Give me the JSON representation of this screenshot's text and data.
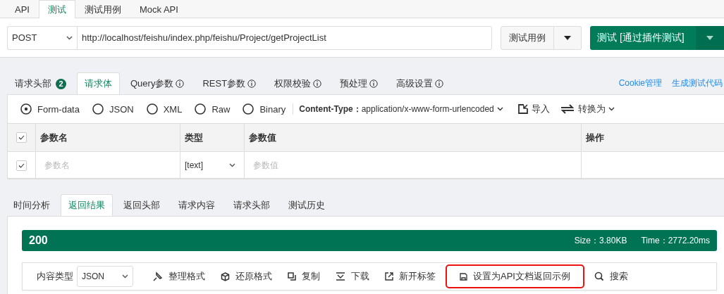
{
  "top_tabs": [
    {
      "label": "API",
      "selected": false
    },
    {
      "label": "测试",
      "selected": true
    },
    {
      "label": "测试用例",
      "selected": false
    },
    {
      "label": "Mock API",
      "selected": false
    }
  ],
  "request": {
    "method": "POST",
    "url": "http://localhost/feishu/index.php/feishu/Project/getProjectList",
    "case_button": "测试用例",
    "test_button": "测试 [通过插件测试]"
  },
  "request_tabs": [
    {
      "label": "请求头部",
      "badge": "2",
      "info": false,
      "selected": false
    },
    {
      "label": "请求体",
      "info": false,
      "selected": true
    },
    {
      "label": "Query参数",
      "info": true,
      "selected": false
    },
    {
      "label": "REST参数",
      "info": true,
      "selected": false
    },
    {
      "label": "权限校验",
      "info": true,
      "selected": false
    },
    {
      "label": "预处理",
      "info": true,
      "selected": false
    },
    {
      "label": "高级设置",
      "info": true,
      "selected": false
    }
  ],
  "request_links": [
    "Cookie管理",
    "生成测试代码"
  ],
  "body_types": [
    {
      "label": "Form-data",
      "selected": true
    },
    {
      "label": "JSON",
      "selected": false
    },
    {
      "label": "XML",
      "selected": false
    },
    {
      "label": "Raw",
      "selected": false
    },
    {
      "label": "Binary",
      "selected": false
    }
  ],
  "content_type": {
    "label": "Content-Type：",
    "value": "application/x-www-form-urlencoded"
  },
  "body_actions": [
    "导入",
    "转换为"
  ],
  "params_table": {
    "all_checked": true,
    "columns": [
      "参数名",
      "类型",
      "参数值",
      "操作"
    ],
    "rows": [
      {
        "checked": true,
        "name_placeholder": "参数名",
        "type": "[text]",
        "value_placeholder": "参数值"
      }
    ]
  },
  "response_tabs": [
    {
      "label": "时间分析",
      "selected": false
    },
    {
      "label": "返回结果",
      "selected": true
    },
    {
      "label": "返回头部",
      "selected": false
    },
    {
      "label": "请求内容",
      "selected": false
    },
    {
      "label": "请求头部",
      "selected": false
    },
    {
      "label": "测试历史",
      "selected": false
    }
  ],
  "status": {
    "code": "200",
    "size": "Size：3.80KB",
    "time": "Time：2772.20ms"
  },
  "toolbar": {
    "content_type_label": "内容类型",
    "content_type": "JSON",
    "actions": [
      {
        "label": "整理格式",
        "highlighted": false
      },
      {
        "label": "还原格式",
        "highlighted": false
      },
      {
        "label": "复制",
        "highlighted": false
      },
      {
        "label": "下载",
        "highlighted": false
      },
      {
        "label": "新开标签",
        "highlighted": false
      },
      {
        "label": "设置为API文档返回示例",
        "highlighted": true
      },
      {
        "label": "搜索",
        "highlighted": false
      }
    ]
  }
}
